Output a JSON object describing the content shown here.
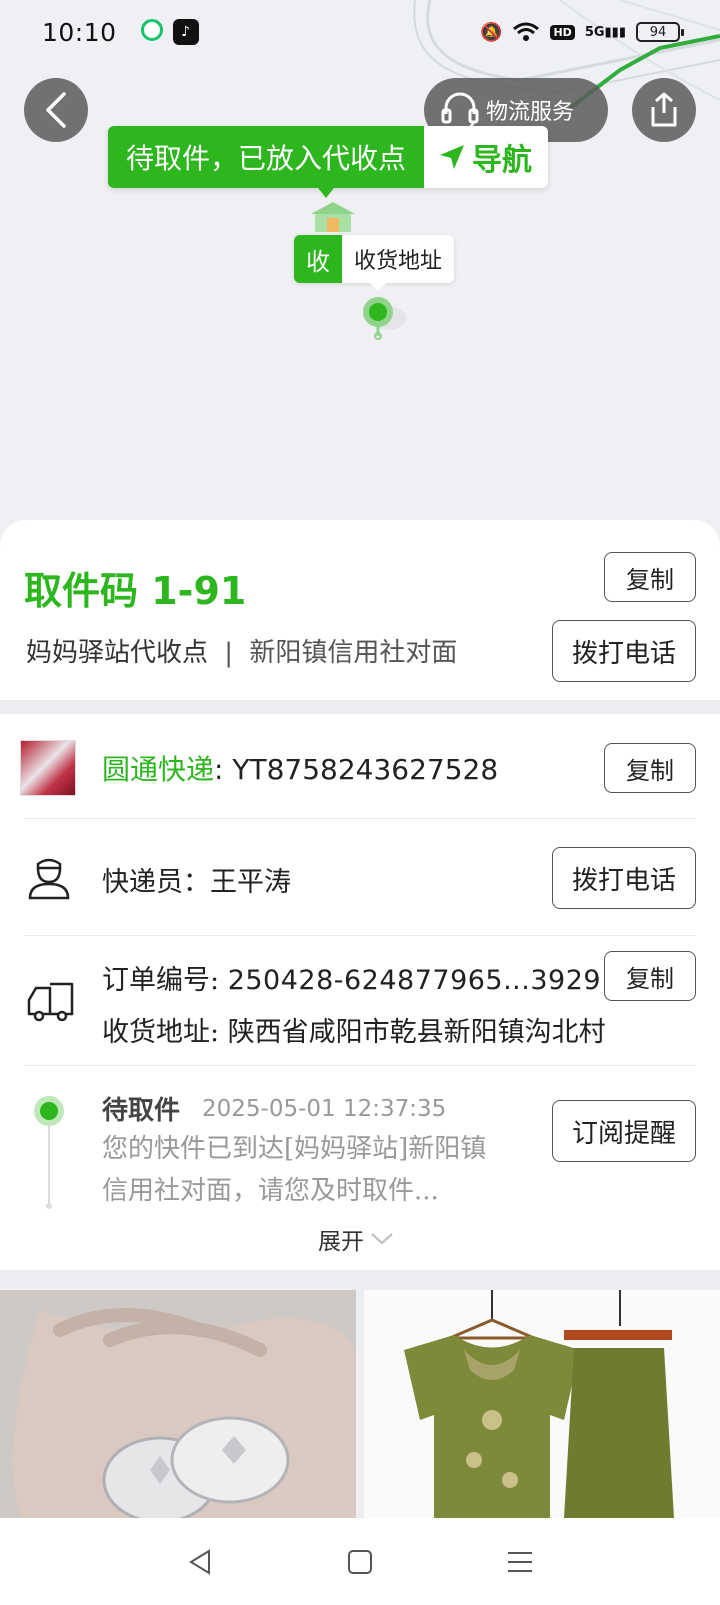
{
  "status_bar": {
    "time": "10:10",
    "battery": "94",
    "network": "5G"
  },
  "map": {
    "logistics_service": "物流服务",
    "callout_status": "待取件，已放入代收点",
    "callout_nav": "导航",
    "receive_tag_short": "收",
    "receive_tag_label": "收货地址"
  },
  "pickup": {
    "code_label": "取件码 1-91",
    "station": "妈妈驿站代收点",
    "separator": "|",
    "location": "新阳镇信用社对面",
    "copy_label": "复制",
    "call_label": "拨打电话"
  },
  "shipment": {
    "carrier": "圆通快递",
    "tracking_prefix": ": ",
    "tracking_number": "YT8758243627528",
    "copy_label": "复制"
  },
  "courier": {
    "label": "快递员：王平涛",
    "call_label": "拨打电话"
  },
  "order": {
    "number_label": "订单编号: ",
    "number_value": "250428-624877965...3929",
    "copy_label": "复制",
    "address_label": "收货地址: ",
    "address_value": "陕西省咸阳市乾县新阳镇沟北村"
  },
  "timeline": {
    "status": "待取件",
    "time": "2025-05-01 12:37:35",
    "description": "您的快件已到达[妈妈驿站]新阳镇信用社对面，请您及时取件...",
    "subscribe_label": "订阅提醒",
    "expand_label": "展开"
  },
  "colors": {
    "accent": "#2db61e",
    "overlay": "#5a5a5a"
  }
}
